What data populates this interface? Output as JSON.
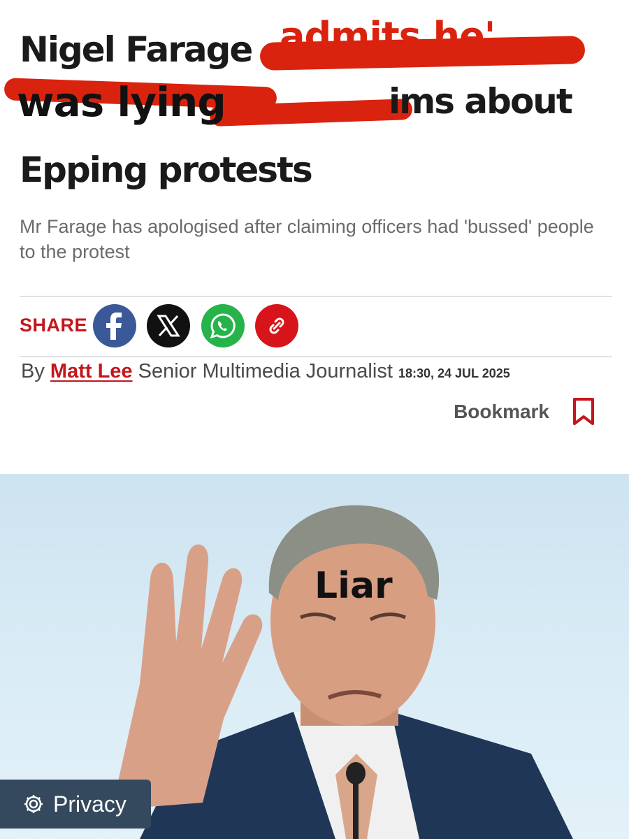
{
  "article": {
    "headline": {
      "line1_visible": "Nigel Farage",
      "line1_overlay": "admits he'",
      "line2_overlay": "was lying",
      "line2_visible": "ims about",
      "line3": "Epping protests"
    },
    "standfirst": "Mr Farage has apologised after claiming officers had 'bussed' people to the protest"
  },
  "share": {
    "label": "SHARE",
    "buttons": [
      {
        "name": "facebook",
        "icon": "facebook-icon",
        "color": "#3b5998"
      },
      {
        "name": "x",
        "icon": "x-icon",
        "color": "#111111"
      },
      {
        "name": "whatsapp",
        "icon": "whatsapp-icon",
        "color": "#25b34a"
      },
      {
        "name": "copy-link",
        "icon": "link-icon",
        "color": "#d6141a"
      }
    ]
  },
  "byline": {
    "prefix": "By",
    "author": "Matt Lee",
    "role": "Senior Multimedia Journalist",
    "timestamp": "18:30, 24 JUL 2025"
  },
  "bookmark": {
    "label": "Bookmark",
    "icon": "bookmark-icon"
  },
  "image": {
    "caption": "Liar"
  },
  "privacy": {
    "label": "Privacy",
    "icon": "gear-icon"
  },
  "colors": {
    "accent": "#c4161c",
    "scribble": "#d9230f",
    "privacy_bg": "#34495e"
  }
}
